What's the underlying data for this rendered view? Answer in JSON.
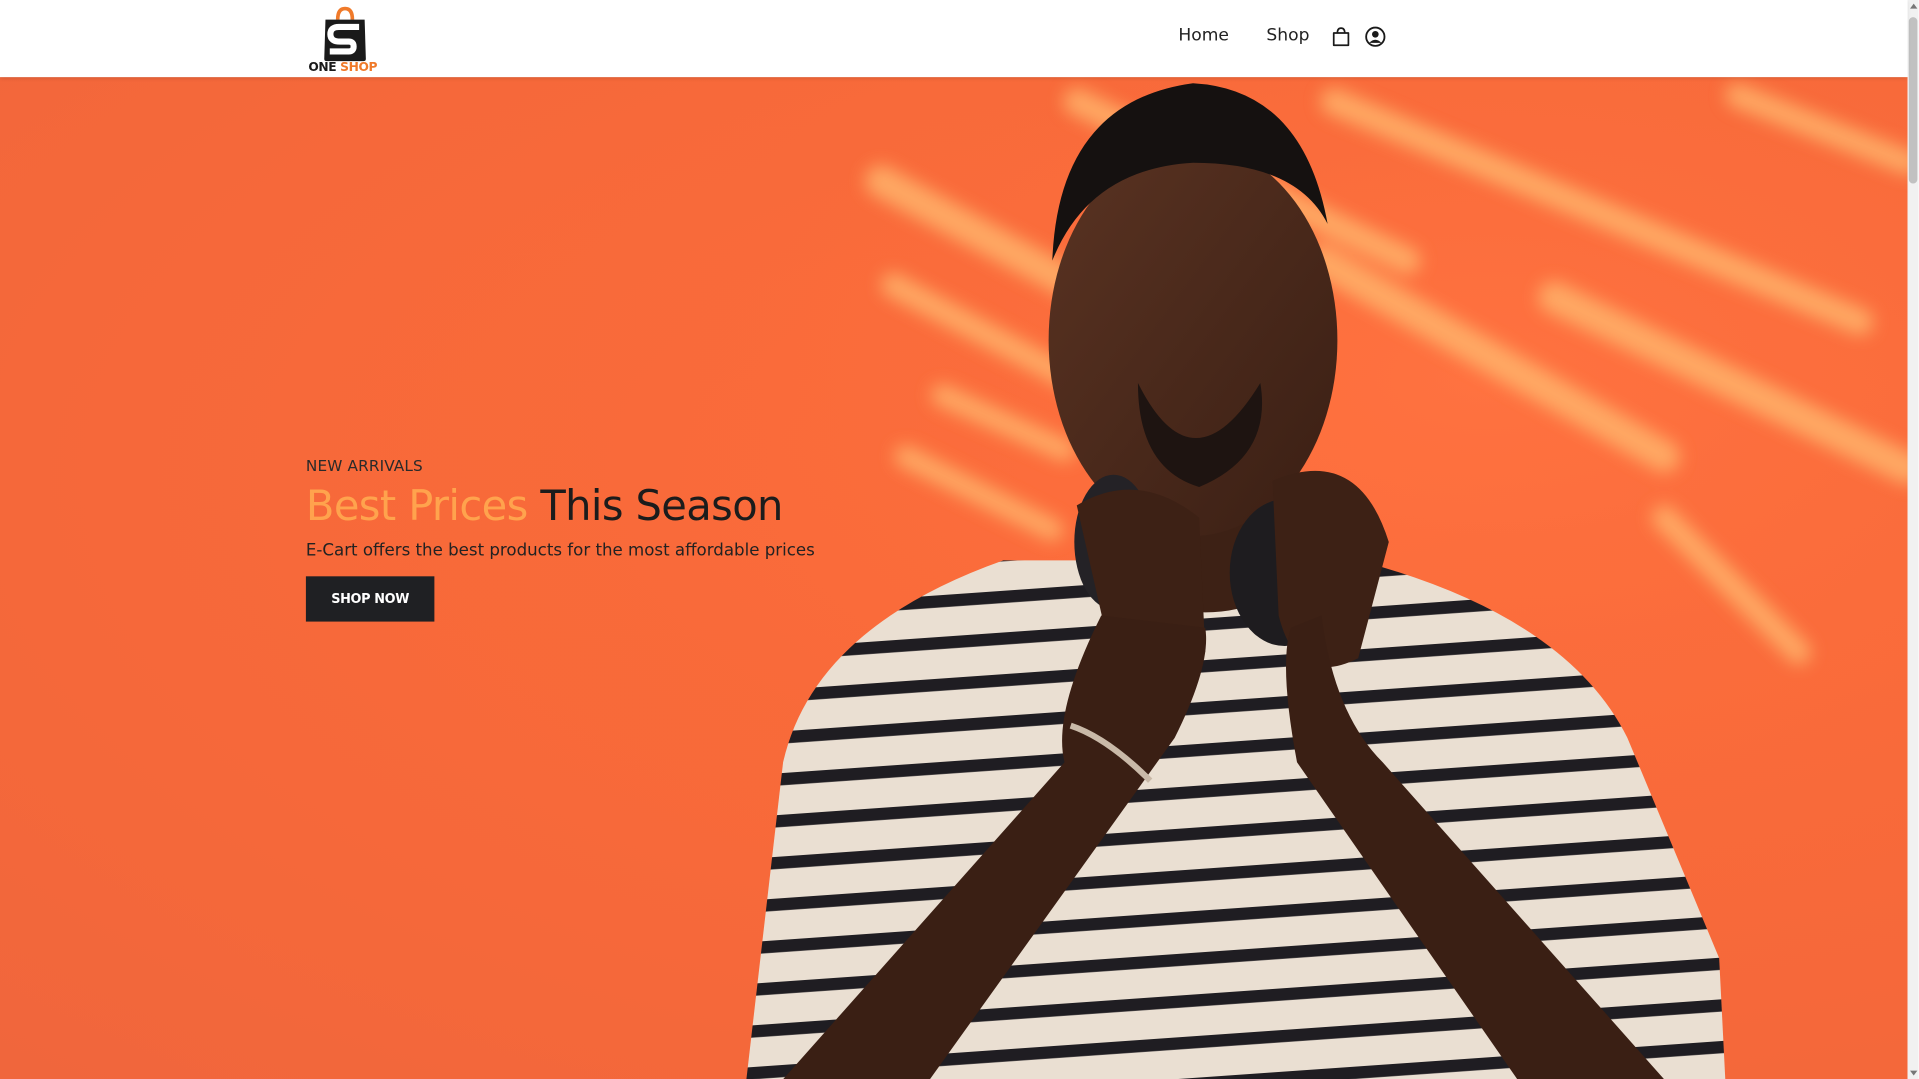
{
  "brand": {
    "name_part1": "ONE",
    "name_part2": "SHOP",
    "logo_icon": "shopping-bag-s-icon",
    "accent_color": "#f07a2a",
    "dark_color": "#1a1a1a"
  },
  "nav": {
    "links": [
      {
        "label": "Home"
      },
      {
        "label": "Shop"
      }
    ],
    "icons": [
      "cart-icon",
      "user-account-icon"
    ]
  },
  "hero": {
    "eyebrow": "NEW ARRIVALS",
    "headline_accent": "Best Prices",
    "headline_rest": "This Season",
    "subtitle": "E-Cart offers the best products for the most affordable prices",
    "cta_label": "SHOP NOW",
    "background_color": "#f96a39",
    "accent_text_color": "#ffa34d",
    "button_color": "#1f2023",
    "image": "man-with-headphones-striped-shirt"
  }
}
